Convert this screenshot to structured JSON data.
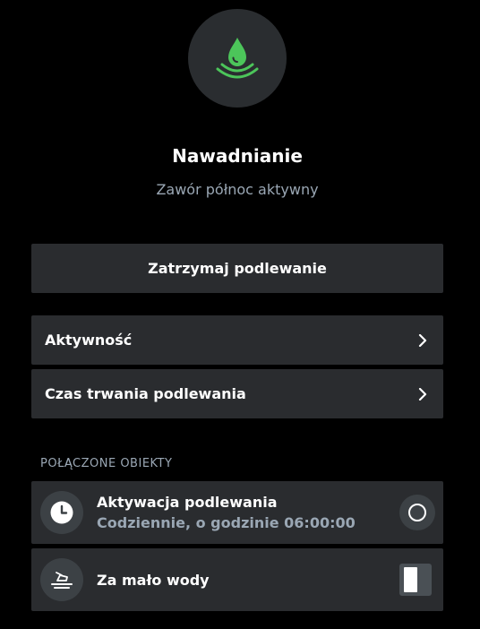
{
  "device": {
    "icon": "water-drop-icon",
    "accent_color": "#4cc55a",
    "title": "Nawadnianie",
    "status": "Zawór północ aktywny"
  },
  "actions": {
    "stop_label": "Zatrzymaj podlewanie"
  },
  "menu": [
    {
      "label": "Aktywność",
      "icon": "chevron-right-icon"
    },
    {
      "label": "Czas trwania podlewania",
      "icon": "chevron-right-icon"
    }
  ],
  "linked": {
    "header": "POŁĄCZONE OBIEKTY",
    "items": [
      {
        "icon": "clock-icon",
        "title": "Aktywacja podlewania",
        "subtitle": "Codziennie, o godzinie 06:00:00",
        "control": "radio",
        "selected": false
      },
      {
        "icon": "low-water-icon",
        "title": "Za mało wody",
        "control": "toggle",
        "on": false
      }
    ]
  }
}
